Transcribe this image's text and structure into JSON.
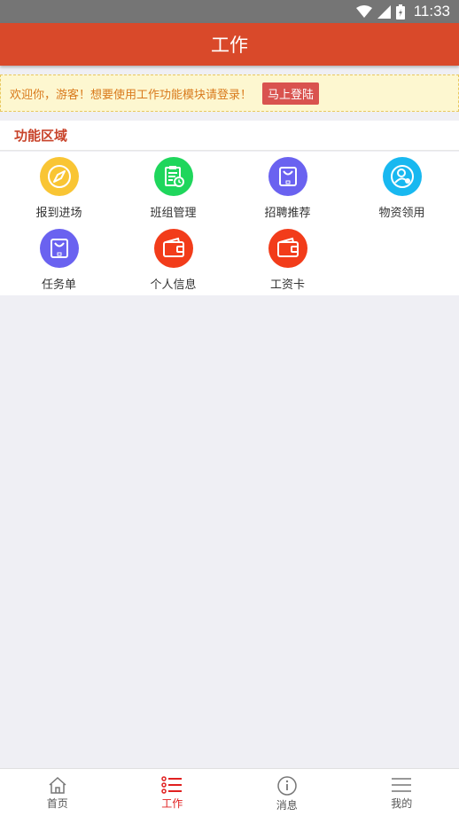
{
  "status_bar": {
    "time": "11:33"
  },
  "header": {
    "title": "工作"
  },
  "notice": {
    "text": "欢迎你，游客！想要使用工作功能模块请登录！",
    "login_label": "马上登陆"
  },
  "section": {
    "title": "功能区域"
  },
  "functions": [
    {
      "label": "报到进场",
      "icon": "compass-icon",
      "color": "#f9c534"
    },
    {
      "label": "班组管理",
      "icon": "clipboard-icon",
      "color": "#1fd65c"
    },
    {
      "label": "招聘推荐",
      "icon": "bag-icon",
      "color": "#6a62f0"
    },
    {
      "label": "物资领用",
      "icon": "user-icon",
      "color": "#18b8f0"
    },
    {
      "label": "任务单",
      "icon": "bag-icon",
      "color": "#6a62f0"
    },
    {
      "label": "个人信息",
      "icon": "wallet-icon",
      "color": "#f23c1a"
    },
    {
      "label": "工资卡",
      "icon": "wallet-icon",
      "color": "#f23c1a"
    }
  ],
  "tabs": [
    {
      "label": "首页",
      "icon": "home-icon"
    },
    {
      "label": "工作",
      "icon": "list-icon",
      "active": true
    },
    {
      "label": "消息",
      "icon": "info-icon"
    },
    {
      "label": "我的",
      "icon": "menu-icon"
    }
  ],
  "colors": {
    "header": "#d9492a",
    "accent": "#e02020",
    "notice_text": "#d97a1c"
  }
}
